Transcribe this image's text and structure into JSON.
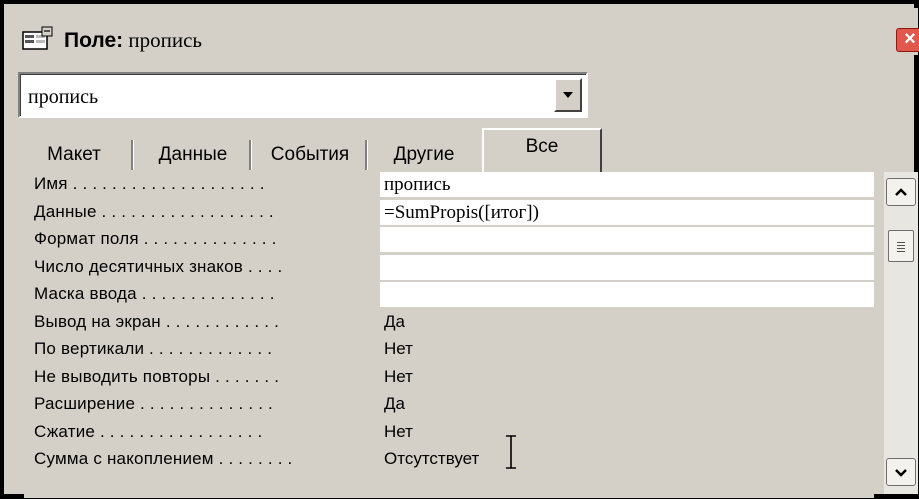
{
  "window": {
    "title_bold": "Поле:",
    "title_rest": " пропись",
    "close_symbol": "×"
  },
  "selector": {
    "value": "пропись"
  },
  "tabs": [
    {
      "label": "Макет"
    },
    {
      "label": "Данные"
    },
    {
      "label": "События"
    },
    {
      "label": "Другие"
    },
    {
      "label": "Все"
    }
  ],
  "active_tab": "Все",
  "properties": [
    {
      "label": "Имя . . . . . . . . . . . . . . . . . . . .",
      "value": "пропись"
    },
    {
      "label": "Данные . . . . . . . . . . . . . . . . . .",
      "value": " =SumPropis([итог])"
    },
    {
      "label": "Формат поля . . . . . . . . . . . . . .",
      "value": ""
    },
    {
      "label": "Число десятичных знаков . . . .",
      "value": ""
    },
    {
      "label": "Маска ввода . . . . . . . . . . . . . .",
      "value": ""
    },
    {
      "label": "Вывод на экран . . . . . . . . . . . .",
      "value": "Да"
    },
    {
      "label": "По вертикали . . . . . . . . . . . . .",
      "value": "Нет"
    },
    {
      "label": "Не выводить повторы . . . . . . .",
      "value": "Нет"
    },
    {
      "label": "Расширение . . . . . . . . . . . . . .",
      "value": "Да"
    },
    {
      "label": "Сжатие . . . . . . . . . . . . . . . . .",
      "value": "Нет"
    },
    {
      "label": "Сумма с накоплением . . . . . . . .",
      "value": "Отсутствует"
    }
  ],
  "colors": {
    "dialog_bg": "#d4d0c8",
    "close_btn": "#e0584b"
  }
}
